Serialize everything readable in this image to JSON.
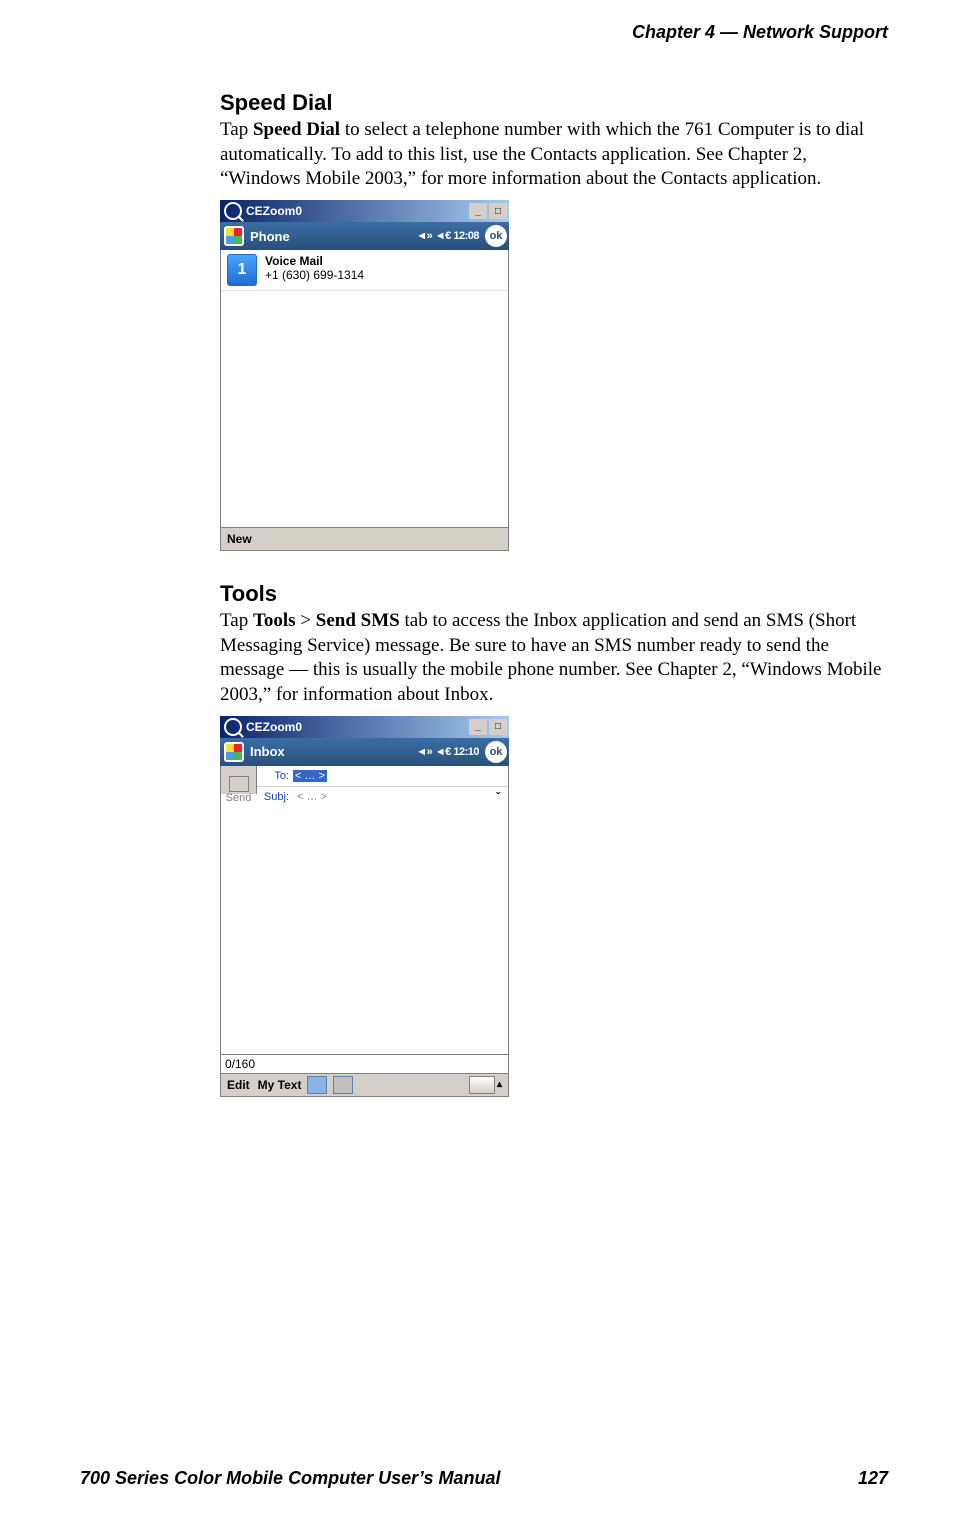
{
  "header": {
    "running": "Chapter  4  —  Network Support"
  },
  "sections": {
    "speedDial": {
      "title": "Speed Dial",
      "para_pre": "Tap ",
      "para_bold": "Speed Dial",
      "para_post": " to select a telephone number with which the 761 Computer is to dial automatically. To add to this list, use the Contacts application. See Chapter 2, “Windows Mobile 2003,” for more information about the Contacts application."
    },
    "tools": {
      "title": "Tools",
      "para_pre": "Tap ",
      "para_bold1": "Tools",
      "para_mid": " > ",
      "para_bold2": "Send SMS",
      "para_post": " tab to access the Inbox application and send an SMS (Short Messaging Service) message. Be sure to have an SMS number ready to send the message — this is usually the mobile phone number. See Chapter 2, “Windows Mobile 2003,” for information about Inbox."
    }
  },
  "screenshot1": {
    "outerTitle": "CEZoom0",
    "nav": {
      "app": "Phone",
      "status": "◄» ◄€ 12:08",
      "ok": "ok"
    },
    "speedDial": {
      "num": "1",
      "name": "Voice Mail",
      "number": "+1 (630) 699-1314"
    },
    "menubar": {
      "new": "New"
    }
  },
  "screenshot2": {
    "outerTitle": "CEZoom0",
    "nav": {
      "app": "Inbox",
      "status": "◄» ◄€ 12:10",
      "ok": "ok"
    },
    "form": {
      "sendLabel": "Send",
      "toLabel": "To:",
      "toValue": "< … >",
      "subjLabel": "Subj:",
      "subjValue": "< … >"
    },
    "charCount": "0/160",
    "menubar": {
      "edit": "Edit",
      "mytext": "My Text"
    }
  },
  "footer": {
    "manual": "700 Series Color Mobile Computer User’s Manual",
    "page": "127"
  }
}
